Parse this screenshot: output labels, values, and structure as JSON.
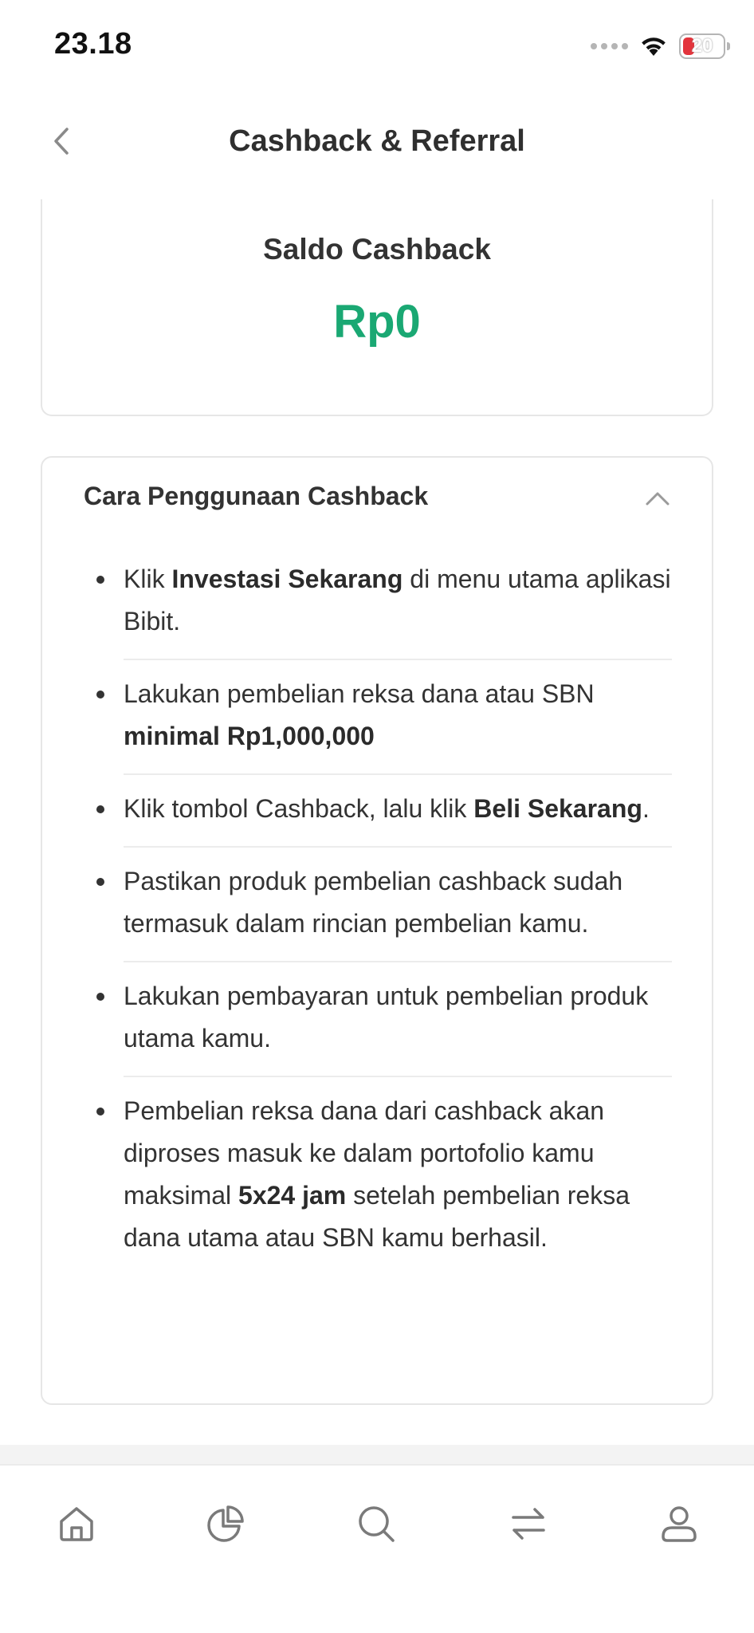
{
  "status_bar": {
    "time": "23.18",
    "battery_level": "20"
  },
  "header": {
    "title": "Cashback & Referral"
  },
  "saldo": {
    "label": "Saldo Cashback",
    "value": "Rp0"
  },
  "usage": {
    "title": "Cara Penggunaan Cashback",
    "steps": [
      [
        {
          "text": "Klik ",
          "bold": false
        },
        {
          "text": "Investasi Sekarang",
          "bold": true
        },
        {
          "text": " di menu utama aplikasi Bibit.",
          "bold": false
        }
      ],
      [
        {
          "text": "Lakukan pembelian reksa dana atau SBN ",
          "bold": false
        },
        {
          "text": "minimal Rp1,000,000",
          "bold": true
        }
      ],
      [
        {
          "text": "Klik tombol Cashback, lalu klik ",
          "bold": false
        },
        {
          "text": "Beli Sekarang",
          "bold": true
        },
        {
          "text": ".",
          "bold": false
        }
      ],
      [
        {
          "text": "Pastikan produk pembelian cashback sudah termasuk dalam rincian pembelian kamu.",
          "bold": false
        }
      ],
      [
        {
          "text": "Lakukan pembayaran untuk pembelian produk utama kamu.",
          "bold": false
        }
      ],
      [
        {
          "text": "Pembelian reksa dana dari cashback akan diproses masuk ke dalam portofolio kamu maksimal ",
          "bold": false
        },
        {
          "text": "5x24 jam",
          "bold": true
        },
        {
          "text": " setelah pembelian reksa dana utama atau SBN kamu berhasil.",
          "bold": false
        }
      ]
    ]
  },
  "bottom_nav": {
    "items": [
      "home-icon",
      "pie-chart-icon",
      "search-icon",
      "transfer-icon",
      "profile-icon"
    ]
  },
  "colors": {
    "accent_green": "#1aa873",
    "battery_low": "#e3343c"
  }
}
